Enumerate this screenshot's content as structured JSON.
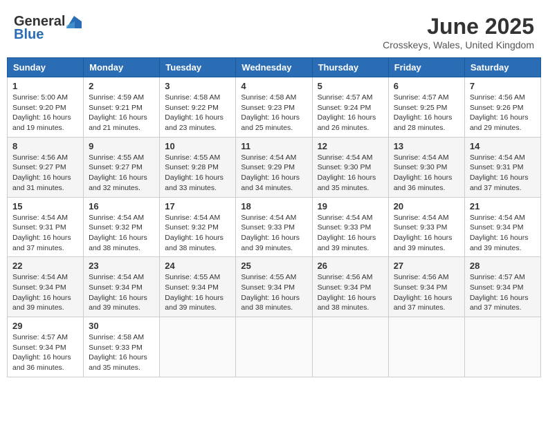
{
  "logo": {
    "general": "General",
    "blue": "Blue"
  },
  "title": "June 2025",
  "subtitle": "Crosskeys, Wales, United Kingdom",
  "headers": [
    "Sunday",
    "Monday",
    "Tuesday",
    "Wednesday",
    "Thursday",
    "Friday",
    "Saturday"
  ],
  "weeks": [
    [
      {
        "day": "1",
        "sunrise": "5:00 AM",
        "sunset": "9:20 PM",
        "daylight": "16 hours and 19 minutes."
      },
      {
        "day": "2",
        "sunrise": "4:59 AM",
        "sunset": "9:21 PM",
        "daylight": "16 hours and 21 minutes."
      },
      {
        "day": "3",
        "sunrise": "4:58 AM",
        "sunset": "9:22 PM",
        "daylight": "16 hours and 23 minutes."
      },
      {
        "day": "4",
        "sunrise": "4:58 AM",
        "sunset": "9:23 PM",
        "daylight": "16 hours and 25 minutes."
      },
      {
        "day": "5",
        "sunrise": "4:57 AM",
        "sunset": "9:24 PM",
        "daylight": "16 hours and 26 minutes."
      },
      {
        "day": "6",
        "sunrise": "4:57 AM",
        "sunset": "9:25 PM",
        "daylight": "16 hours and 28 minutes."
      },
      {
        "day": "7",
        "sunrise": "4:56 AM",
        "sunset": "9:26 PM",
        "daylight": "16 hours and 29 minutes."
      }
    ],
    [
      {
        "day": "8",
        "sunrise": "4:56 AM",
        "sunset": "9:27 PM",
        "daylight": "16 hours and 31 minutes."
      },
      {
        "day": "9",
        "sunrise": "4:55 AM",
        "sunset": "9:27 PM",
        "daylight": "16 hours and 32 minutes."
      },
      {
        "day": "10",
        "sunrise": "4:55 AM",
        "sunset": "9:28 PM",
        "daylight": "16 hours and 33 minutes."
      },
      {
        "day": "11",
        "sunrise": "4:54 AM",
        "sunset": "9:29 PM",
        "daylight": "16 hours and 34 minutes."
      },
      {
        "day": "12",
        "sunrise": "4:54 AM",
        "sunset": "9:30 PM",
        "daylight": "16 hours and 35 minutes."
      },
      {
        "day": "13",
        "sunrise": "4:54 AM",
        "sunset": "9:30 PM",
        "daylight": "16 hours and 36 minutes."
      },
      {
        "day": "14",
        "sunrise": "4:54 AM",
        "sunset": "9:31 PM",
        "daylight": "16 hours and 37 minutes."
      }
    ],
    [
      {
        "day": "15",
        "sunrise": "4:54 AM",
        "sunset": "9:31 PM",
        "daylight": "16 hours and 37 minutes."
      },
      {
        "day": "16",
        "sunrise": "4:54 AM",
        "sunset": "9:32 PM",
        "daylight": "16 hours and 38 minutes."
      },
      {
        "day": "17",
        "sunrise": "4:54 AM",
        "sunset": "9:32 PM",
        "daylight": "16 hours and 38 minutes."
      },
      {
        "day": "18",
        "sunrise": "4:54 AM",
        "sunset": "9:33 PM",
        "daylight": "16 hours and 39 minutes."
      },
      {
        "day": "19",
        "sunrise": "4:54 AM",
        "sunset": "9:33 PM",
        "daylight": "16 hours and 39 minutes."
      },
      {
        "day": "20",
        "sunrise": "4:54 AM",
        "sunset": "9:33 PM",
        "daylight": "16 hours and 39 minutes."
      },
      {
        "day": "21",
        "sunrise": "4:54 AM",
        "sunset": "9:34 PM",
        "daylight": "16 hours and 39 minutes."
      }
    ],
    [
      {
        "day": "22",
        "sunrise": "4:54 AM",
        "sunset": "9:34 PM",
        "daylight": "16 hours and 39 minutes."
      },
      {
        "day": "23",
        "sunrise": "4:54 AM",
        "sunset": "9:34 PM",
        "daylight": "16 hours and 39 minutes."
      },
      {
        "day": "24",
        "sunrise": "4:55 AM",
        "sunset": "9:34 PM",
        "daylight": "16 hours and 39 minutes."
      },
      {
        "day": "25",
        "sunrise": "4:55 AM",
        "sunset": "9:34 PM",
        "daylight": "16 hours and 38 minutes."
      },
      {
        "day": "26",
        "sunrise": "4:56 AM",
        "sunset": "9:34 PM",
        "daylight": "16 hours and 38 minutes."
      },
      {
        "day": "27",
        "sunrise": "4:56 AM",
        "sunset": "9:34 PM",
        "daylight": "16 hours and 37 minutes."
      },
      {
        "day": "28",
        "sunrise": "4:57 AM",
        "sunset": "9:34 PM",
        "daylight": "16 hours and 37 minutes."
      }
    ],
    [
      {
        "day": "29",
        "sunrise": "4:57 AM",
        "sunset": "9:34 PM",
        "daylight": "16 hours and 36 minutes."
      },
      {
        "day": "30",
        "sunrise": "4:58 AM",
        "sunset": "9:33 PM",
        "daylight": "16 hours and 35 minutes."
      },
      null,
      null,
      null,
      null,
      null
    ]
  ]
}
